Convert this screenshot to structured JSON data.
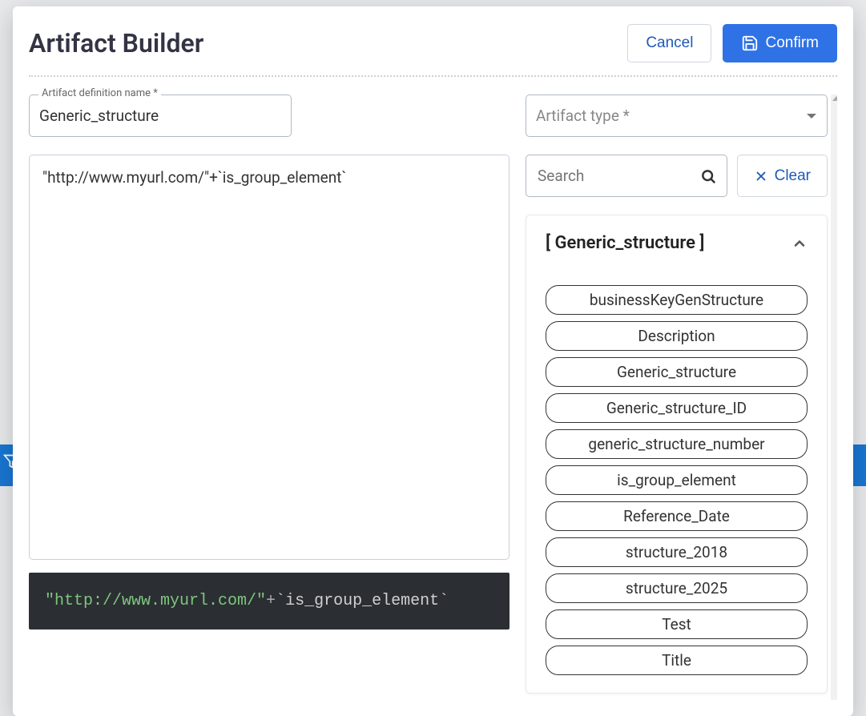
{
  "modal": {
    "title": "Artifact Builder",
    "cancel_label": "Cancel",
    "confirm_label": "Confirm"
  },
  "left": {
    "name_label": "Artifact definition name *",
    "name_value": "Generic_structure",
    "expression_value": "\"http://www.myurl.com/\"+`is_group_element`",
    "preview_str": "\"http://www.myurl.com/\"",
    "preview_op": "+",
    "preview_var": "`is_group_element`"
  },
  "right": {
    "type_label": "Artifact type *",
    "search_placeholder": "Search",
    "clear_label": "Clear",
    "panel_title": "[ Generic_structure ]",
    "chips": [
      "businessKeyGenStructure",
      "Description",
      "Generic_structure",
      "Generic_structure_ID",
      "generic_structure_number",
      "is_group_element",
      "Reference_Date",
      "structure_2018",
      "structure_2025",
      "Test",
      "Title"
    ]
  }
}
